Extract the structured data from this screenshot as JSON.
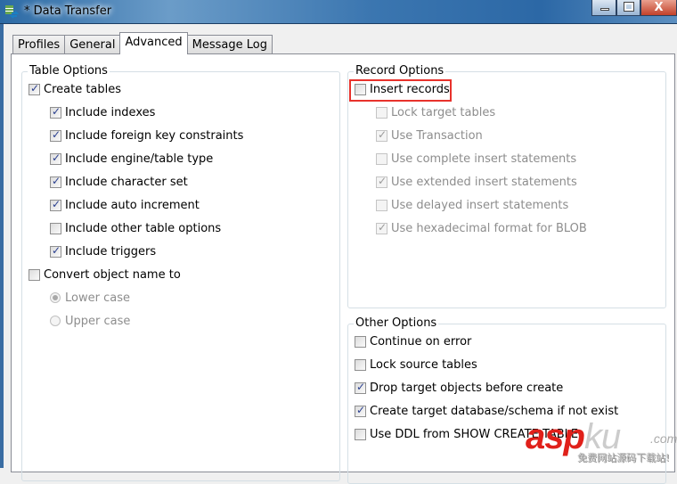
{
  "window": {
    "title": "* Data Transfer",
    "close": "X"
  },
  "tabs": [
    {
      "label": "Profiles"
    },
    {
      "label": "General"
    },
    {
      "label": "Advanced",
      "active": true
    },
    {
      "label": "Message Log"
    }
  ],
  "table_options": {
    "title": "Table Options",
    "create_tables": {
      "label": "Create tables",
      "checked": true
    },
    "items": [
      {
        "label": "Include indexes",
        "checked": true
      },
      {
        "label": "Include foreign key constraints",
        "checked": true
      },
      {
        "label": "Include engine/table type",
        "checked": true
      },
      {
        "label": "Include character set",
        "checked": true
      },
      {
        "label": "Include auto increment",
        "checked": true
      },
      {
        "label": "Include other table options",
        "checked": false
      },
      {
        "label": "Include triggers",
        "checked": true
      }
    ],
    "convert": {
      "label": "Convert object name to",
      "checked": false
    },
    "cases": [
      {
        "label": "Lower case",
        "selected": true
      },
      {
        "label": "Upper case",
        "selected": false
      }
    ]
  },
  "record_options": {
    "title": "Record Options",
    "insert_records": {
      "label": "Insert records",
      "checked": false
    },
    "items": [
      {
        "label": "Lock target tables",
        "checked": false
      },
      {
        "label": "Use Transaction",
        "checked": true
      },
      {
        "label": "Use complete insert statements",
        "checked": false
      },
      {
        "label": "Use extended insert statements",
        "checked": true
      },
      {
        "label": "Use delayed insert statements",
        "checked": false
      },
      {
        "label": "Use hexadecimal format for BLOB",
        "checked": true
      }
    ]
  },
  "other_options": {
    "title": "Other Options",
    "items": [
      {
        "label": "Continue on error",
        "checked": false
      },
      {
        "label": "Lock source tables",
        "checked": false
      },
      {
        "label": "Drop target objects before create",
        "checked": true
      },
      {
        "label": "Create target database/schema if not exist",
        "checked": true
      },
      {
        "label": "Use DDL from SHOW CREATE TABLE",
        "checked": false
      }
    ]
  },
  "watermark": {
    "brand": "asp",
    "brand2": "ku",
    "domain": ".com",
    "slogan": "免费网站源码下载站!"
  },
  "colors": {
    "highlight": "#e8322c",
    "titlebar": "#2c6aa5"
  }
}
